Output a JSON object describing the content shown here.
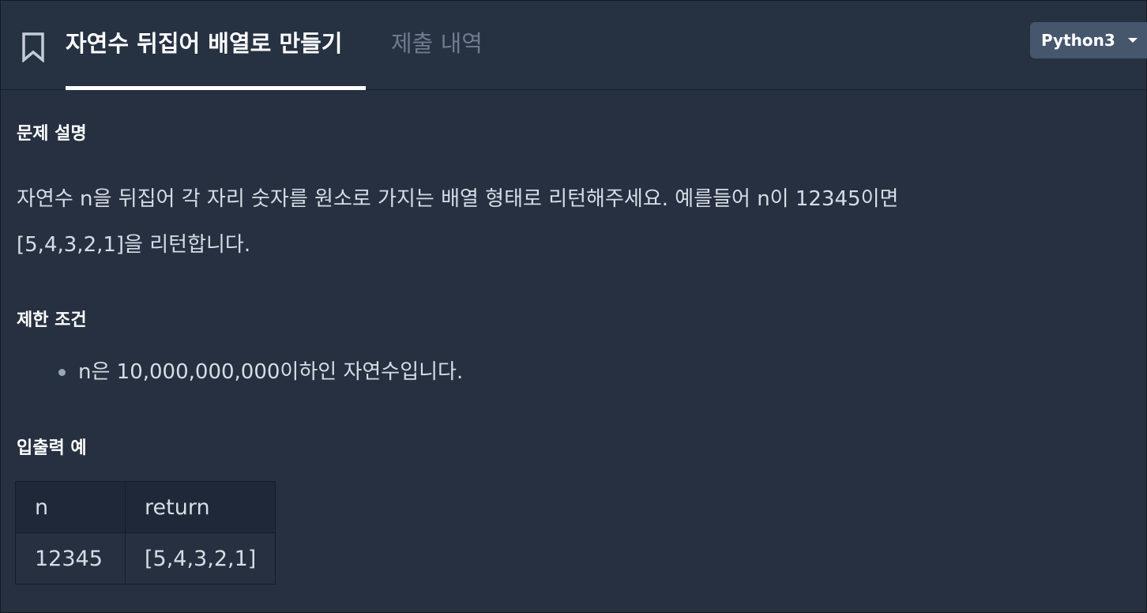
{
  "header": {
    "active_tab": "자연수 뒤집어 배열로 만들기",
    "inactive_tab": "제출 내역",
    "language": "Python3",
    "bookmark_icon": "bookmark-icon"
  },
  "problem": {
    "description_title": "문제 설명",
    "description_line1": "자연수 n을 뒤집어 각 자리 숫자를 원소로 가지는 배열 형태로 리턴해주세요. 예를들어 n이 12345이면",
    "description_line2": "[5,4,3,2,1]을 리턴합니다.",
    "constraints_title": "제한 조건",
    "constraints": [
      "n은 10,000,000,000이하인 자연수입니다."
    ],
    "examples_title": "입출력 예",
    "examples_table": {
      "headers": [
        "n",
        "return"
      ],
      "rows": [
        [
          "12345",
          "[5,4,3,2,1]"
        ]
      ]
    }
  }
}
